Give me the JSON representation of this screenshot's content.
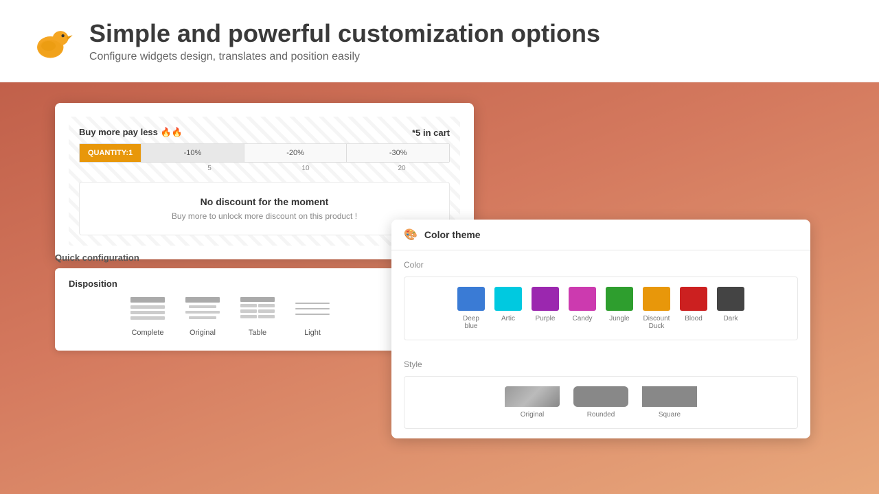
{
  "header": {
    "title": "Simple and powerful customization options",
    "subtitle": "Configure widgets design, translates and position easily"
  },
  "widget": {
    "buy_more_label": "Buy more pay less 🔥🔥",
    "cart_info": "*5 in cart",
    "quantity_label": "QUANTITY:1",
    "segments": [
      {
        "label": "-10%",
        "number": "5"
      },
      {
        "label": "-20%",
        "number": "10"
      },
      {
        "label": "-30%",
        "number": "20"
      }
    ],
    "no_discount_title": "No discount for the moment",
    "no_discount_text": "Buy more to unlock more discount on this product !"
  },
  "quick_config": {
    "title": "Quick configuration",
    "disposition": {
      "title": "Disposition",
      "options": [
        {
          "label": "Complete"
        },
        {
          "label": "Original"
        },
        {
          "label": "Table"
        },
        {
          "label": "Light"
        }
      ]
    }
  },
  "color_theme": {
    "title": "Color theme",
    "color_section_label": "Color",
    "colors": [
      {
        "name": "Deep blue",
        "hex": "#3a7bd5"
      },
      {
        "name": "Artic",
        "hex": "#00c9e0"
      },
      {
        "name": "Purple",
        "hex": "#9b27af"
      },
      {
        "name": "Candy",
        "hex": "#cc3aaf"
      },
      {
        "name": "Jungle",
        "hex": "#2e9e2e"
      },
      {
        "name": "Discount Duck",
        "hex": "#e8970a"
      },
      {
        "name": "Blood",
        "hex": "#cc2020"
      },
      {
        "name": "Dark",
        "hex": "#444444"
      }
    ],
    "style_section_label": "Style",
    "styles": [
      {
        "name": "Original"
      },
      {
        "name": "Rounded"
      },
      {
        "name": "Square"
      }
    ]
  }
}
